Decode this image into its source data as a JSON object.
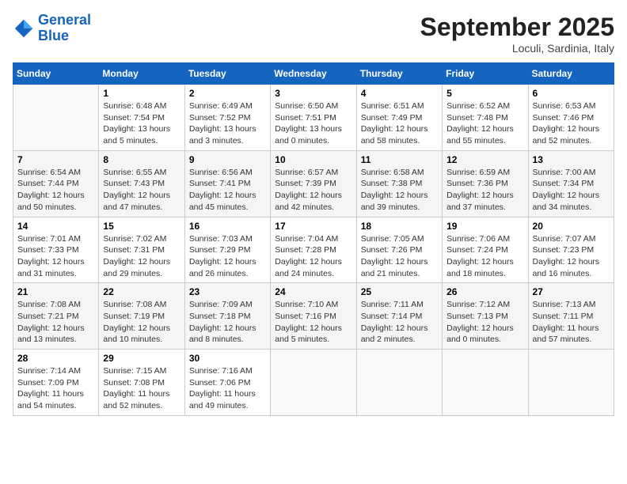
{
  "header": {
    "logo_line1": "General",
    "logo_line2": "Blue",
    "month_title": "September 2025",
    "location": "Loculi, Sardinia, Italy"
  },
  "weekdays": [
    "Sunday",
    "Monday",
    "Tuesday",
    "Wednesday",
    "Thursday",
    "Friday",
    "Saturday"
  ],
  "weeks": [
    [
      {
        "day": "",
        "sunrise": "",
        "sunset": "",
        "daylight": ""
      },
      {
        "day": "1",
        "sunrise": "Sunrise: 6:48 AM",
        "sunset": "Sunset: 7:54 PM",
        "daylight": "Daylight: 13 hours and 5 minutes."
      },
      {
        "day": "2",
        "sunrise": "Sunrise: 6:49 AM",
        "sunset": "Sunset: 7:52 PM",
        "daylight": "Daylight: 13 hours and 3 minutes."
      },
      {
        "day": "3",
        "sunrise": "Sunrise: 6:50 AM",
        "sunset": "Sunset: 7:51 PM",
        "daylight": "Daylight: 13 hours and 0 minutes."
      },
      {
        "day": "4",
        "sunrise": "Sunrise: 6:51 AM",
        "sunset": "Sunset: 7:49 PM",
        "daylight": "Daylight: 12 hours and 58 minutes."
      },
      {
        "day": "5",
        "sunrise": "Sunrise: 6:52 AM",
        "sunset": "Sunset: 7:48 PM",
        "daylight": "Daylight: 12 hours and 55 minutes."
      },
      {
        "day": "6",
        "sunrise": "Sunrise: 6:53 AM",
        "sunset": "Sunset: 7:46 PM",
        "daylight": "Daylight: 12 hours and 52 minutes."
      }
    ],
    [
      {
        "day": "7",
        "sunrise": "Sunrise: 6:54 AM",
        "sunset": "Sunset: 7:44 PM",
        "daylight": "Daylight: 12 hours and 50 minutes."
      },
      {
        "day": "8",
        "sunrise": "Sunrise: 6:55 AM",
        "sunset": "Sunset: 7:43 PM",
        "daylight": "Daylight: 12 hours and 47 minutes."
      },
      {
        "day": "9",
        "sunrise": "Sunrise: 6:56 AM",
        "sunset": "Sunset: 7:41 PM",
        "daylight": "Daylight: 12 hours and 45 minutes."
      },
      {
        "day": "10",
        "sunrise": "Sunrise: 6:57 AM",
        "sunset": "Sunset: 7:39 PM",
        "daylight": "Daylight: 12 hours and 42 minutes."
      },
      {
        "day": "11",
        "sunrise": "Sunrise: 6:58 AM",
        "sunset": "Sunset: 7:38 PM",
        "daylight": "Daylight: 12 hours and 39 minutes."
      },
      {
        "day": "12",
        "sunrise": "Sunrise: 6:59 AM",
        "sunset": "Sunset: 7:36 PM",
        "daylight": "Daylight: 12 hours and 37 minutes."
      },
      {
        "day": "13",
        "sunrise": "Sunrise: 7:00 AM",
        "sunset": "Sunset: 7:34 PM",
        "daylight": "Daylight: 12 hours and 34 minutes."
      }
    ],
    [
      {
        "day": "14",
        "sunrise": "Sunrise: 7:01 AM",
        "sunset": "Sunset: 7:33 PM",
        "daylight": "Daylight: 12 hours and 31 minutes."
      },
      {
        "day": "15",
        "sunrise": "Sunrise: 7:02 AM",
        "sunset": "Sunset: 7:31 PM",
        "daylight": "Daylight: 12 hours and 29 minutes."
      },
      {
        "day": "16",
        "sunrise": "Sunrise: 7:03 AM",
        "sunset": "Sunset: 7:29 PM",
        "daylight": "Daylight: 12 hours and 26 minutes."
      },
      {
        "day": "17",
        "sunrise": "Sunrise: 7:04 AM",
        "sunset": "Sunset: 7:28 PM",
        "daylight": "Daylight: 12 hours and 24 minutes."
      },
      {
        "day": "18",
        "sunrise": "Sunrise: 7:05 AM",
        "sunset": "Sunset: 7:26 PM",
        "daylight": "Daylight: 12 hours and 21 minutes."
      },
      {
        "day": "19",
        "sunrise": "Sunrise: 7:06 AM",
        "sunset": "Sunset: 7:24 PM",
        "daylight": "Daylight: 12 hours and 18 minutes."
      },
      {
        "day": "20",
        "sunrise": "Sunrise: 7:07 AM",
        "sunset": "Sunset: 7:23 PM",
        "daylight": "Daylight: 12 hours and 16 minutes."
      }
    ],
    [
      {
        "day": "21",
        "sunrise": "Sunrise: 7:08 AM",
        "sunset": "Sunset: 7:21 PM",
        "daylight": "Daylight: 12 hours and 13 minutes."
      },
      {
        "day": "22",
        "sunrise": "Sunrise: 7:08 AM",
        "sunset": "Sunset: 7:19 PM",
        "daylight": "Daylight: 12 hours and 10 minutes."
      },
      {
        "day": "23",
        "sunrise": "Sunrise: 7:09 AM",
        "sunset": "Sunset: 7:18 PM",
        "daylight": "Daylight: 12 hours and 8 minutes."
      },
      {
        "day": "24",
        "sunrise": "Sunrise: 7:10 AM",
        "sunset": "Sunset: 7:16 PM",
        "daylight": "Daylight: 12 hours and 5 minutes."
      },
      {
        "day": "25",
        "sunrise": "Sunrise: 7:11 AM",
        "sunset": "Sunset: 7:14 PM",
        "daylight": "Daylight: 12 hours and 2 minutes."
      },
      {
        "day": "26",
        "sunrise": "Sunrise: 7:12 AM",
        "sunset": "Sunset: 7:13 PM",
        "daylight": "Daylight: 12 hours and 0 minutes."
      },
      {
        "day": "27",
        "sunrise": "Sunrise: 7:13 AM",
        "sunset": "Sunset: 7:11 PM",
        "daylight": "Daylight: 11 hours and 57 minutes."
      }
    ],
    [
      {
        "day": "28",
        "sunrise": "Sunrise: 7:14 AM",
        "sunset": "Sunset: 7:09 PM",
        "daylight": "Daylight: 11 hours and 54 minutes."
      },
      {
        "day": "29",
        "sunrise": "Sunrise: 7:15 AM",
        "sunset": "Sunset: 7:08 PM",
        "daylight": "Daylight: 11 hours and 52 minutes."
      },
      {
        "day": "30",
        "sunrise": "Sunrise: 7:16 AM",
        "sunset": "Sunset: 7:06 PM",
        "daylight": "Daylight: 11 hours and 49 minutes."
      },
      {
        "day": "",
        "sunrise": "",
        "sunset": "",
        "daylight": ""
      },
      {
        "day": "",
        "sunrise": "",
        "sunset": "",
        "daylight": ""
      },
      {
        "day": "",
        "sunrise": "",
        "sunset": "",
        "daylight": ""
      },
      {
        "day": "",
        "sunrise": "",
        "sunset": "",
        "daylight": ""
      }
    ]
  ]
}
